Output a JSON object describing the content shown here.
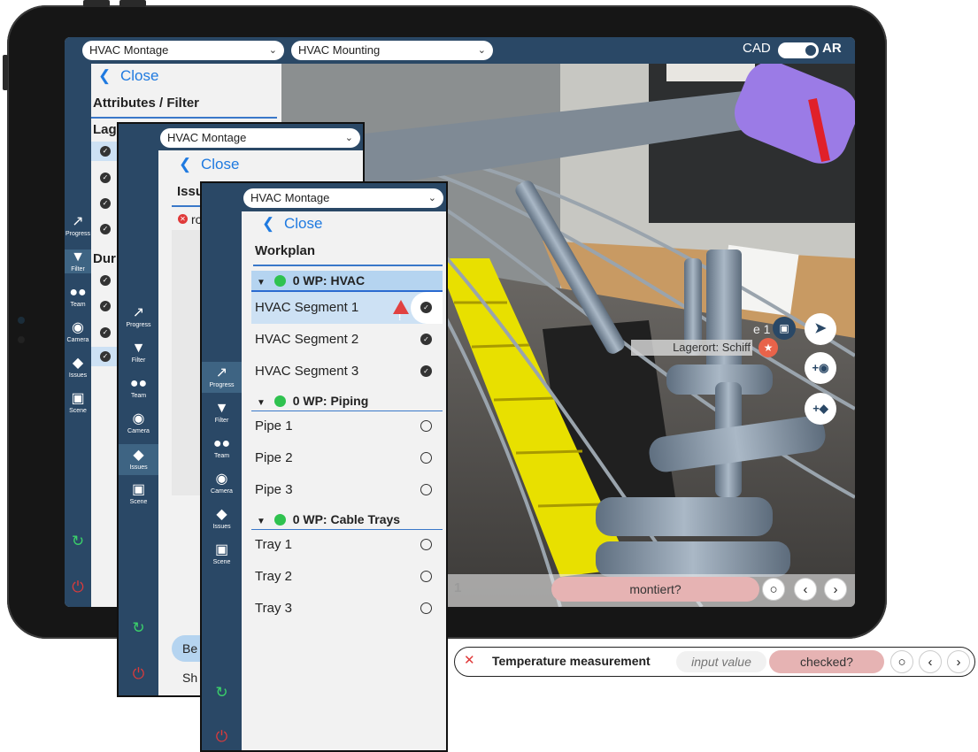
{
  "main_screen": {
    "montage_select": "HVAC Montage",
    "mounting_select": "HVAC Mounting",
    "cad_label": "CAD",
    "ar_label": "AR",
    "close_label": "Close",
    "attributes_title": "Attributes / Filter",
    "lager_partial": "Lag",
    "dur_partial": "Dur",
    "overlay_label_partial": "e 1",
    "lagerort_label": "Lagerort: Schiff",
    "bottom_label_partial": "1",
    "montiert_label": "montiert?"
  },
  "rail": {
    "items": [
      {
        "label": "Progress",
        "icon": "trending-up-icon"
      },
      {
        "label": "Filter",
        "icon": "filter-icon"
      },
      {
        "label": "Team",
        "icon": "team-icon"
      },
      {
        "label": "Camera",
        "icon": "camera-icon"
      },
      {
        "label": "Issues",
        "icon": "location-pin-icon"
      },
      {
        "label": "Scene",
        "icon": "scene-icon"
      }
    ]
  },
  "issues_window": {
    "select": "HVAC Montage",
    "close_label": "Close",
    "title_partial": "Issu",
    "issue_partial": "ro",
    "bottom_btn_partial": "Be",
    "bottom_text_partial": "Sh"
  },
  "workplan_window": {
    "select": "HVAC Montage",
    "close_label": "Close",
    "title": "Workplan",
    "groups": [
      {
        "title": "0 WP: HVAC",
        "items": [
          {
            "label": "HVAC Segment 1",
            "state": "done",
            "warning": true
          },
          {
            "label": "HVAC Segment 2",
            "state": "done",
            "warning": false
          },
          {
            "label": "HVAC Segment 3",
            "state": "done",
            "warning": false
          }
        ]
      },
      {
        "title": "0 WP: Piping",
        "items": [
          {
            "label": "Pipe 1",
            "state": "open"
          },
          {
            "label": "Pipe 2",
            "state": "open"
          },
          {
            "label": "Pipe 3",
            "state": "open"
          }
        ]
      },
      {
        "title": "0 WP: Cable Trays",
        "items": [
          {
            "label": "Tray 1",
            "state": "open"
          },
          {
            "label": "Tray 2",
            "state": "open"
          },
          {
            "label": "Tray 3",
            "state": "open"
          }
        ]
      }
    ]
  },
  "temperature_bar": {
    "title": "Temperature measurement",
    "input_placeholder": "input value",
    "checked_label": "checked?"
  },
  "colors": {
    "rail": "#2a4866",
    "accent_blue": "#1f7ae0",
    "status_green": "#2fc24f",
    "pink": "#e6b3b3",
    "warning": "#e14141"
  }
}
